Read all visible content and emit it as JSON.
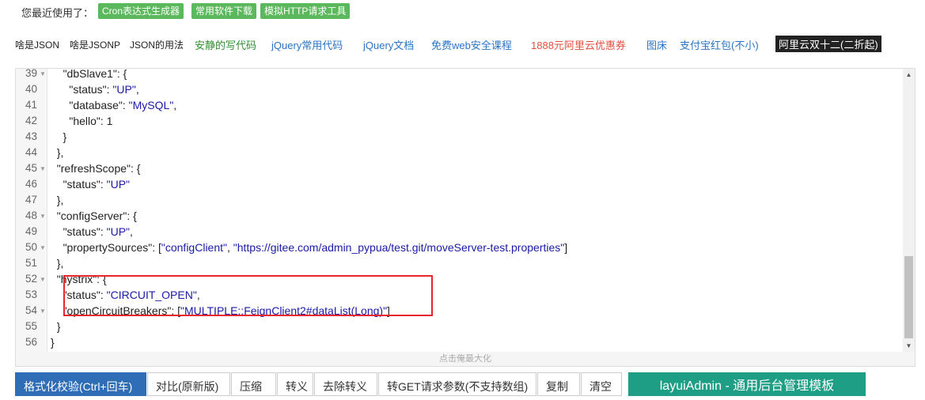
{
  "recent": {
    "label": "您最近使用了：",
    "tags": [
      "Cron表达式生成器",
      "常用软件下载",
      "模拟HTTP请求工具"
    ]
  },
  "links": [
    {
      "text": "啥是JSON",
      "style": "dark"
    },
    {
      "text": "啥是JSONP",
      "style": "dark"
    },
    {
      "text": "JSON的用法",
      "style": "dark"
    },
    {
      "text": "安静的写代码",
      "style": "green"
    },
    {
      "text": "jQuery常用代码",
      "style": "blue"
    },
    {
      "text": "jQuery文档",
      "style": "blue"
    },
    {
      "text": "免费web安全课程",
      "style": "blue"
    },
    {
      "text": "1888元阿里云优惠券",
      "style": "red"
    },
    {
      "text": "图床",
      "style": "blue"
    },
    {
      "text": "支付宝红包(不小)",
      "style": "blue"
    },
    {
      "text": "阿里云双十二(二折起)",
      "style": "badge"
    }
  ],
  "editor": {
    "lines": [
      {
        "n": "39",
        "fold": true,
        "code": "    \"dbSlave1\": {"
      },
      {
        "n": "40",
        "fold": false,
        "code": "      \"status\": \"UP\","
      },
      {
        "n": "41",
        "fold": false,
        "code": "      \"database\": \"MySQL\","
      },
      {
        "n": "42",
        "fold": false,
        "code": "      \"hello\": 1"
      },
      {
        "n": "43",
        "fold": false,
        "code": "    }"
      },
      {
        "n": "44",
        "fold": false,
        "code": "  },"
      },
      {
        "n": "45",
        "fold": true,
        "code": "  \"refreshScope\": {"
      },
      {
        "n": "46",
        "fold": false,
        "code": "    \"status\": \"UP\""
      },
      {
        "n": "47",
        "fold": false,
        "code": "  },"
      },
      {
        "n": "48",
        "fold": true,
        "code": "  \"configServer\": {"
      },
      {
        "n": "49",
        "fold": false,
        "code": "    \"status\": \"UP\","
      },
      {
        "n": "50",
        "fold": true,
        "code": "    \"propertySources\": [\"configClient\", \"https://gitee.com/admin_pypua/test.git/moveServer-test.properties\"]"
      },
      {
        "n": "51",
        "fold": false,
        "code": "  },"
      },
      {
        "n": "52",
        "fold": true,
        "code": "  \"hystrix\": {"
      },
      {
        "n": "53",
        "fold": false,
        "code": "    \"status\": \"CIRCUIT_OPEN\","
      },
      {
        "n": "54",
        "fold": true,
        "code": "    \"openCircuitBreakers\": [\"MULTIPLE::FeignClient2#dataList(Long)\"]"
      },
      {
        "n": "55",
        "fold": false,
        "code": "  }"
      },
      {
        "n": "56",
        "fold": false,
        "code": "}"
      }
    ],
    "maximize_label": "点击俺最大化"
  },
  "toolbar": {
    "buttons": [
      "格式化校验(Ctrl+回车)",
      "对比(原新版)",
      "压缩",
      "转义",
      "去除转义",
      "转GET请求参数(不支持数组)",
      "复制",
      "清空"
    ],
    "ad_label": "layuiAdmin - 通用后台管理模板"
  },
  "colors": {
    "tag_green": "#5cb85c",
    "primary_blue": "#2f6eb7",
    "highlight_red": "#e8262b",
    "ad_teal": "#1f9e86"
  }
}
